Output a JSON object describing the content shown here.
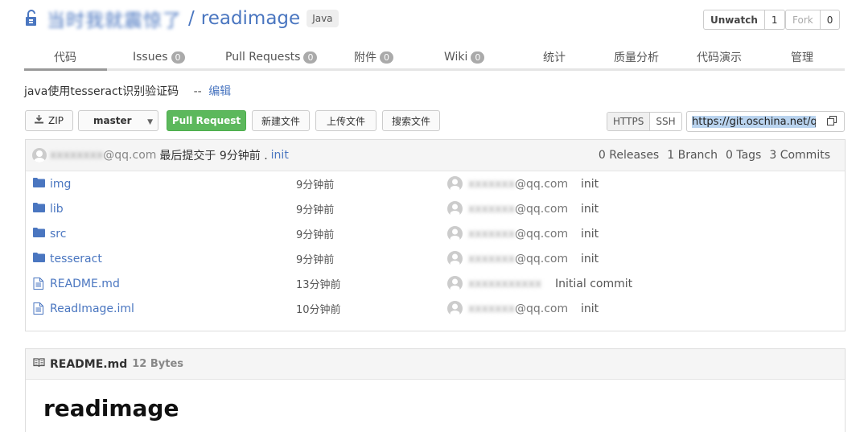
{
  "repo": {
    "owner": "当时我就震惊了",
    "separator": "/",
    "name": "readimage",
    "language": "Java"
  },
  "actions": {
    "watch_label": "Unwatch",
    "watch_count": "1",
    "fork_label": "Fork",
    "fork_count": "0"
  },
  "tabs": [
    {
      "label": "代码"
    },
    {
      "label": "Issues",
      "badge": "0"
    },
    {
      "label": "Pull Requests",
      "badge": "0"
    },
    {
      "label": "附件",
      "badge": "0"
    },
    {
      "label": "Wiki",
      "badge": "0"
    },
    {
      "label": "统计"
    },
    {
      "label": "质量分析"
    },
    {
      "label": "代码演示"
    },
    {
      "label": "管理"
    }
  ],
  "description": {
    "text": "java使用tesseract识别验证码",
    "separator": "--",
    "edit_label": "编辑"
  },
  "toolbar": {
    "zip_label": "ZIP",
    "branch": "master",
    "pull_request_label": "Pull Request",
    "new_file_label": "新建文件",
    "upload_label": "上传文件",
    "search_label": "搜索文件",
    "https_label": "HTTPS",
    "ssh_label": "SSH",
    "clone_url": "https://git.oschina.net/qi"
  },
  "last_commit": {
    "author": "@qq.com",
    "message": "最后提交于 9分钟前 .",
    "commit_msg": "init"
  },
  "stats": {
    "releases": "0 Releases",
    "branches": "1 Branch",
    "tags": "0 Tags",
    "commits": "3 Commits"
  },
  "files": [
    {
      "name": "img",
      "type": "folder",
      "time": "9分钟前",
      "author": "@qq.com",
      "message": "init"
    },
    {
      "name": "lib",
      "type": "folder",
      "time": "9分钟前",
      "author": "@qq.com",
      "message": "init"
    },
    {
      "name": "src",
      "type": "folder",
      "time": "9分钟前",
      "author": "@qq.com",
      "message": "init"
    },
    {
      "name": "tesseract",
      "type": "folder",
      "time": "9分钟前",
      "author": "@qq.com",
      "message": "init"
    },
    {
      "name": "README.md",
      "type": "file",
      "time": "13分钟前",
      "author": "",
      "message": "Initial commit"
    },
    {
      "name": "ReadImage.iml",
      "type": "file",
      "time": "10分钟前",
      "author": "@qq.com",
      "message": "init"
    }
  ],
  "readme": {
    "filename": "README.md",
    "size": "12 Bytes",
    "heading": "readimage"
  }
}
